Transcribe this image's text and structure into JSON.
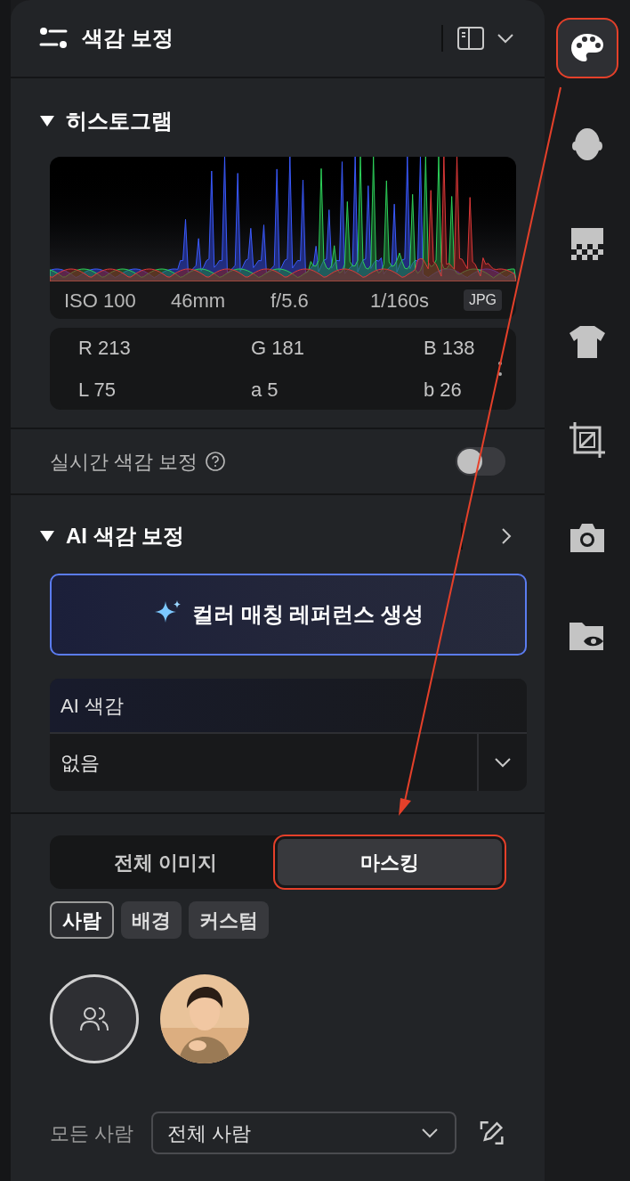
{
  "header": {
    "title": "색감 보정"
  },
  "histogram": {
    "title": "히스토그램",
    "expanded": true,
    "exif": [
      "ISO 100",
      "46mm",
      "f/5.6",
      "1/160s"
    ],
    "format": "JPG",
    "readings": [
      [
        "R 213",
        "G 181",
        "B 138"
      ],
      [
        "L 75",
        "a 5",
        "b 26"
      ]
    ]
  },
  "realtime": {
    "label": "실시간 색감 보정",
    "on": false
  },
  "ai": {
    "title": "AI 색감 보정",
    "expanded": true,
    "generate_button": "컬러 매칭 레퍼런스 생성",
    "style_label": "AI 색감",
    "style_value": "없음"
  },
  "scope_tabs": [
    {
      "label": "전체 이미지",
      "selected": false,
      "highlighted": false
    },
    {
      "label": "마스킹",
      "selected": true,
      "highlighted": true
    }
  ],
  "mask_types": [
    {
      "label": "사람",
      "selected": true
    },
    {
      "label": "배경",
      "selected": false
    },
    {
      "label": "커스텀",
      "selected": false
    }
  ],
  "people": [
    {
      "kind": "all",
      "selected": true
    },
    {
      "kind": "picture",
      "selected": false
    }
  ],
  "person_filter": {
    "label": "모든 사람",
    "value": "전체 사람"
  },
  "tools": [
    {
      "kind": "palette",
      "selected": true,
      "highlighted": true
    },
    {
      "kind": "face",
      "selected": false,
      "highlighted": false
    },
    {
      "kind": "checker",
      "selected": false,
      "highlighted": false
    },
    {
      "kind": "shirt",
      "selected": false,
      "highlighted": false
    },
    {
      "kind": "crop",
      "selected": false,
      "highlighted": false
    },
    {
      "kind": "camera",
      "selected": false,
      "highlighted": false
    },
    {
      "kind": "folder",
      "selected": false,
      "highlighted": false
    }
  ]
}
